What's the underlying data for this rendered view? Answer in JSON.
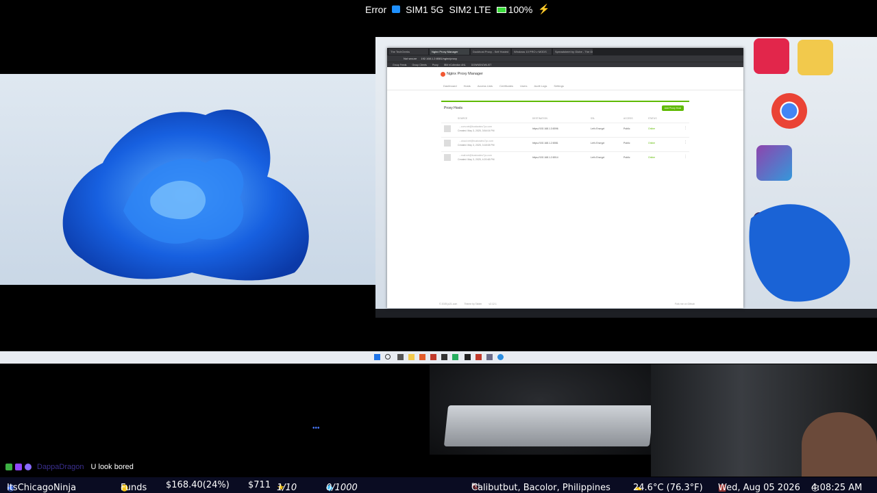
{
  "status_bar": {
    "error_label": "Error",
    "sim1": "SIM1 5G",
    "sim2": "SIM2 LTE",
    "battery": "100%",
    "battery_level": 1.0
  },
  "browser": {
    "tabs": [
      "The TechGeeks",
      "Nginx Proxy Manager",
      "Dockhost Proxy - Self Hosted",
      "Windows 10 PRO v MODS",
      "Spreadsheet by Globe - The Globe"
    ],
    "active_tab": 1,
    "address_prefix": "Not secure",
    "address": "192.168.1.2:8081/nginx/proxy",
    "bookmarks": [
      "Group Feeds",
      "Group Clients",
      "Proxy",
      "IBM eCollection ANL",
      "DOWNSNOWLIST"
    ],
    "app_title": "Nginx Proxy Manager",
    "menu": [
      "Dashboard",
      "Hosts",
      "Access Lists",
      "Certificates",
      "Users",
      "Audit Logs",
      "Settings"
    ],
    "card_title": "Proxy Hosts",
    "add_button": "Add Proxy Host",
    "columns": [
      "SOURCE",
      "DESTINATION",
      "SSL",
      "ACCESS",
      "STATUS"
    ],
    "rows": [
      {
        "source": "...com.net@busisrateo7yc.com",
        "created": "Created: May 3, 2025, 3:54:04 PM",
        "destination": "https://192.168.1.3:8096",
        "ssl": "Let's Encrypt",
        "access": "Public",
        "status": "Online"
      },
      {
        "source": "...cloud.net@busisrateo7yc.com",
        "created": "Created: May 3, 2025, 3:18:08 PM",
        "destination": "https://192.168.1.2:8081",
        "ssl": "Let's Encrypt",
        "access": "Public",
        "status": "Online"
      },
      {
        "source": "...mail.net@busisrateo7yc.com",
        "created": "Created: May 3, 2025, 4:20:48 PM",
        "destination": "https://192.168.1.2:8014",
        "ssl": "Let's Encrypt",
        "access": "Public",
        "status": "Online"
      }
    ],
    "footer_left": "© 2025 jc21.com",
    "footer_mid": "Theme by Tabler",
    "footer_ver": "v2.12.1",
    "footer_right": "Fork me on Github"
  },
  "chat": {
    "username": "DappaDragon",
    "message": "U look bored",
    "typing_indicator": "•••"
  },
  "info_bar": {
    "channel": "ItsChicagoNinja",
    "funds_label": "Funds",
    "funds_value": "$168.40(24%)",
    "goal": "$711",
    "stars": "1/10",
    "gems": "0/1000",
    "location": "Calibutbut, Bacolor, Philippines",
    "country_code": "PH",
    "weather": "24.6°C (76.3°F)",
    "date": "Wed, Aug 05 2026",
    "time": "4:08:25 AM"
  },
  "colors": {
    "accent_green": "#5eba00",
    "info_bar_bg": "#0a0c22",
    "funds_chip": "#2a62c9",
    "username_color": "#6a5acd"
  }
}
